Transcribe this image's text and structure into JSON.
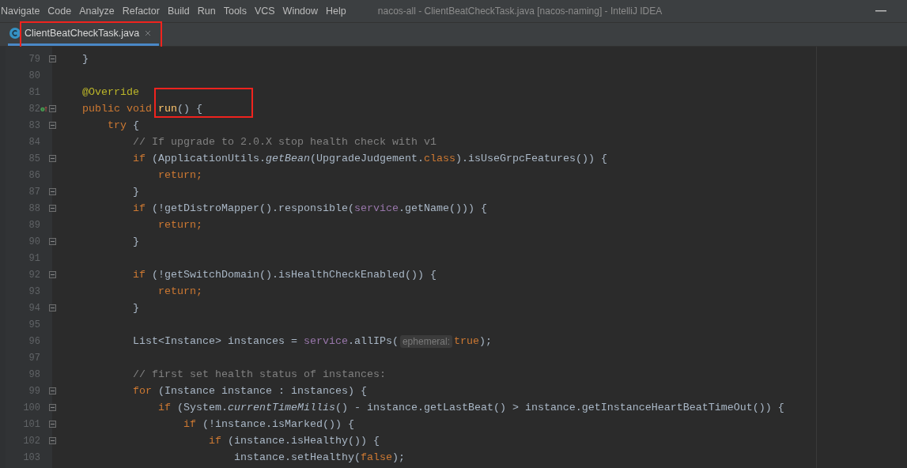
{
  "menu": [
    "Navigate",
    "Code",
    "Analyze",
    "Refactor",
    "Build",
    "Run",
    "Tools",
    "VCS",
    "Window",
    "Help"
  ],
  "window": {
    "title": "nacos-all - ClientBeatCheckTask.java [nacos-naming] - IntelliJ IDEA"
  },
  "tabs": [
    {
      "label": "ClientBeatCheckTask.java",
      "selected": true,
      "highlighted": true
    }
  ],
  "lines": [
    {
      "number": "79",
      "fold": true,
      "tokens": [
        {
          "kind": "plain",
          "text": "    }"
        }
      ]
    },
    {
      "number": "80",
      "fold": false
    },
    {
      "number": "81",
      "fold": false,
      "tokens": [
        {
          "kind": "ann",
          "text": "    @Override"
        }
      ]
    },
    {
      "number": "82",
      "fold": true,
      "override": true,
      "tokens": [
        {
          "kind": "kw",
          "text": "    public void "
        },
        {
          "kind": "fn",
          "text": "run",
          "boxed": true
        },
        {
          "kind": "plain",
          "text": "() {",
          "boxed": true
        }
      ]
    },
    {
      "number": "83",
      "fold": true,
      "tokens": [
        {
          "kind": "kw",
          "text": "        try"
        },
        {
          "kind": "plain",
          "text": " {"
        }
      ]
    },
    {
      "number": "84",
      "fold": false,
      "tokens": [
        {
          "kind": "cm",
          "text": "            // If upgrade to 2.0.X stop health check with v1"
        }
      ]
    },
    {
      "number": "85",
      "fold": true,
      "tokens": [
        {
          "kind": "kw",
          "text": "            if"
        },
        {
          "kind": "plain",
          "text": " (ApplicationUtils."
        },
        {
          "kind": "it",
          "text": "getBean"
        },
        {
          "kind": "plain",
          "text": "(UpgradeJudgement."
        },
        {
          "kind": "kw",
          "text": "class"
        },
        {
          "kind": "plain",
          "text": ").isUseGrpcFeatures()) {"
        }
      ]
    },
    {
      "number": "86",
      "fold": false,
      "tokens": [
        {
          "kind": "kw",
          "text": "                return;"
        }
      ]
    },
    {
      "number": "87",
      "fold": true,
      "tokens": [
        {
          "kind": "plain",
          "text": "            }"
        }
      ]
    },
    {
      "number": "88",
      "fold": true,
      "tokens": [
        {
          "kind": "kw",
          "text": "            if"
        },
        {
          "kind": "plain",
          "text": " (!getDistroMapper().responsible("
        },
        {
          "kind": "field",
          "text": "service"
        },
        {
          "kind": "plain",
          "text": ".getName())) {"
        }
      ]
    },
    {
      "number": "89",
      "fold": false,
      "tokens": [
        {
          "kind": "kw",
          "text": "                return;"
        }
      ]
    },
    {
      "number": "90",
      "fold": true,
      "tokens": [
        {
          "kind": "plain",
          "text": "            }"
        }
      ]
    },
    {
      "number": "91",
      "fold": false
    },
    {
      "number": "92",
      "fold": true,
      "tokens": [
        {
          "kind": "kw",
          "text": "            if"
        },
        {
          "kind": "plain",
          "text": " (!getSwitchDomain().isHealthCheckEnabled()) {"
        }
      ]
    },
    {
      "number": "93",
      "fold": false,
      "tokens": [
        {
          "kind": "kw",
          "text": "                return;"
        }
      ]
    },
    {
      "number": "94",
      "fold": true,
      "tokens": [
        {
          "kind": "plain",
          "text": "            }"
        }
      ]
    },
    {
      "number": "95",
      "fold": false
    },
    {
      "number": "96",
      "fold": false,
      "tokens": [
        {
          "kind": "plain",
          "text": "            List<Instance> instances = "
        },
        {
          "kind": "field",
          "text": "service"
        },
        {
          "kind": "plain",
          "text": ".allIPs("
        },
        {
          "kind": "hint",
          "text": "ephemeral:"
        },
        {
          "kind": "kw",
          "text": "true"
        },
        {
          "kind": "plain",
          "text": ");"
        }
      ]
    },
    {
      "number": "97",
      "fold": false
    },
    {
      "number": "98",
      "fold": false,
      "tokens": [
        {
          "kind": "cm",
          "text": "            // first set health status of instances:"
        }
      ]
    },
    {
      "number": "99",
      "fold": true,
      "tokens": [
        {
          "kind": "kw",
          "text": "            for"
        },
        {
          "kind": "plain",
          "text": " (Instance instance : instances) {"
        }
      ]
    },
    {
      "number": "100",
      "fold": true,
      "tokens": [
        {
          "kind": "kw",
          "text": "                if"
        },
        {
          "kind": "plain",
          "text": " (System."
        },
        {
          "kind": "it",
          "text": "currentTimeMillis"
        },
        {
          "kind": "plain",
          "text": "() - instance.getLastBeat() > instance.getInstanceHeartBeatTimeOut()) {"
        }
      ]
    },
    {
      "number": "101",
      "fold": true,
      "tokens": [
        {
          "kind": "kw",
          "text": "                    if"
        },
        {
          "kind": "plain",
          "text": " (!instance.isMarked()) {"
        }
      ]
    },
    {
      "number": "102",
      "fold": true,
      "tokens": [
        {
          "kind": "kw",
          "text": "                        if"
        },
        {
          "kind": "plain",
          "text": " (instance.isHealthy()) {"
        }
      ]
    },
    {
      "number": "103",
      "fold": false,
      "tokens": [
        {
          "kind": "plain",
          "text": "                            instance.setHealthy("
        },
        {
          "kind": "kw",
          "text": "false"
        },
        {
          "kind": "plain",
          "text": ");"
        }
      ]
    }
  ]
}
